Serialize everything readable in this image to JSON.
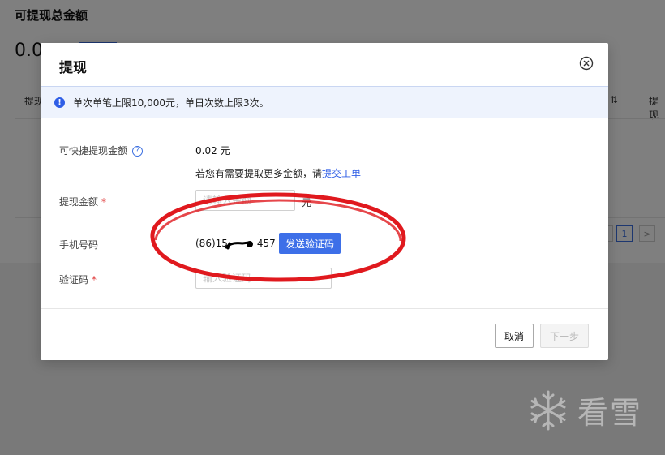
{
  "background": {
    "title": "可提现总金额",
    "amount": "0.0",
    "table_header_left": "提现",
    "table_header_right": "提现",
    "sort_icon": "sort-icon",
    "pagination": {
      "current": "1",
      "next": ">"
    }
  },
  "modal": {
    "title": "提现",
    "close_icon": "close-circle-icon",
    "notice": {
      "icon": "info-icon",
      "text": "单次单笔上限10,000元，单日次数上限3次。"
    },
    "quick_amount": {
      "label": "可快捷提现金额",
      "help_icon": "question-icon",
      "value": "0.02 元"
    },
    "hint": {
      "prefix": "若您有需要提取更多金额，请",
      "link": "提交工单"
    },
    "withdraw_amount": {
      "label": "提现金额",
      "required": "*",
      "placeholder": "请输入金额",
      "unit": "元"
    },
    "phone": {
      "label": "手机号码",
      "prefix": "(86)15",
      "suffix": "457",
      "send_button": "发送验证码"
    },
    "code": {
      "label": "验证码",
      "required": "*",
      "placeholder": "输入验证码"
    },
    "footer": {
      "cancel": "取消",
      "next": "下一步"
    }
  },
  "watermark": {
    "icon": "snowflake-icon",
    "text": "看雪"
  },
  "colors": {
    "primary": "#3d6fe8",
    "annotation": "#e0191e",
    "required": "#e03a3a"
  }
}
